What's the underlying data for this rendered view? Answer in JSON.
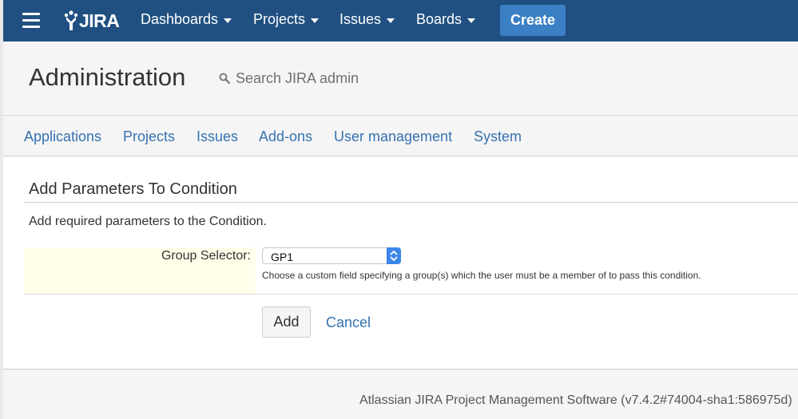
{
  "topbar": {
    "logo_text": "JIRA",
    "nav": [
      {
        "label": "Dashboards"
      },
      {
        "label": "Projects"
      },
      {
        "label": "Issues"
      },
      {
        "label": "Boards"
      }
    ],
    "create_label": "Create",
    "bg_color": "#205081"
  },
  "admin": {
    "title": "Administration",
    "search_placeholder": "Search JIRA admin"
  },
  "tabs": [
    {
      "label": "Applications"
    },
    {
      "label": "Projects"
    },
    {
      "label": "Issues"
    },
    {
      "label": "Add-ons"
    },
    {
      "label": "User management"
    },
    {
      "label": "System"
    }
  ],
  "form": {
    "title": "Add Parameters To Condition",
    "description": "Add required parameters to the Condition.",
    "field_label": "Group Selector:",
    "field_value": "GP1",
    "field_help": "Choose a custom field specifying a group(s) which the user must be a member of to pass this condition.",
    "submit_label": "Add",
    "cancel_label": "Cancel"
  },
  "footer": {
    "text": "Atlassian JIRA Project Management Software (v7.4.2#74004-sha1:586975d)"
  }
}
